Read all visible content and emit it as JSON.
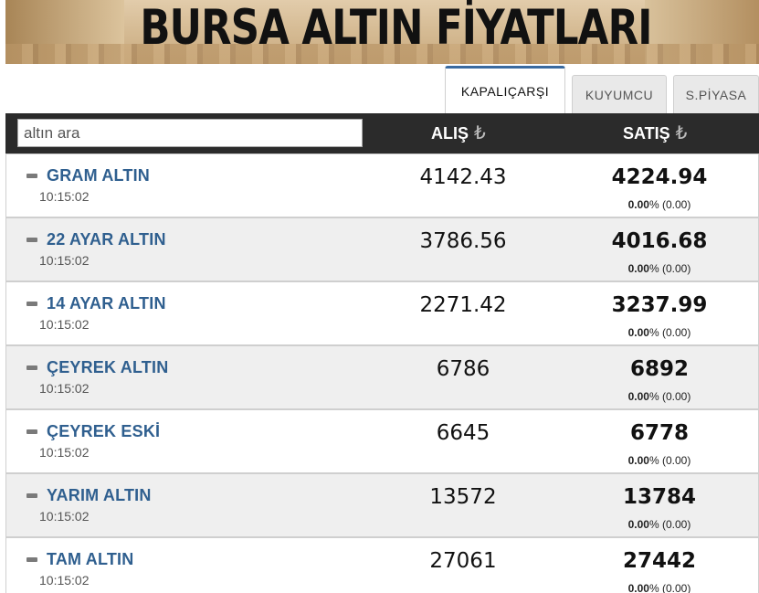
{
  "banner": {
    "title": "BURSA ALTIN FİYATLARI"
  },
  "tabs": [
    {
      "label": "KAPALIÇARŞI",
      "active": true
    },
    {
      "label": "KUYUMCU",
      "active": false
    },
    {
      "label": "S.PİYASA",
      "active": false
    }
  ],
  "search": {
    "placeholder": "altın ara",
    "value": ""
  },
  "columns": {
    "buy": "ALIŞ",
    "sell": "SATIŞ",
    "currency_icon": "₺"
  },
  "rows": [
    {
      "name": "GRAM ALTIN",
      "time": "10:15:02",
      "buy": "4142.43",
      "sell": "4224.94",
      "change_pct": "0.00",
      "pct_sign": "%",
      "change_abs": "(0.00)"
    },
    {
      "name": "22 AYAR ALTIN",
      "time": "10:15:02",
      "buy": "3786.56",
      "sell": "4016.68",
      "change_pct": "0.00",
      "pct_sign": "%",
      "change_abs": "(0.00)"
    },
    {
      "name": "14 AYAR ALTIN",
      "time": "10:15:02",
      "buy": "2271.42",
      "sell": "3237.99",
      "change_pct": "0.00",
      "pct_sign": "%",
      "change_abs": "(0.00)"
    },
    {
      "name": "ÇEYREK ALTIN",
      "time": "10:15:02",
      "buy": "6786",
      "sell": "6892",
      "change_pct": "0.00",
      "pct_sign": "%",
      "change_abs": "(0.00)"
    },
    {
      "name": "ÇEYREK ESKİ",
      "time": "10:15:02",
      "buy": "6645",
      "sell": "6778",
      "change_pct": "0.00",
      "pct_sign": "%",
      "change_abs": "(0.00)"
    },
    {
      "name": "YARIM ALTIN",
      "time": "10:15:02",
      "buy": "13572",
      "sell": "13784",
      "change_pct": "0.00",
      "pct_sign": "%",
      "change_abs": "(0.00)"
    },
    {
      "name": "TAM ALTIN",
      "time": "10:15:02",
      "buy": "27061",
      "sell": "27442",
      "change_pct": "0.00",
      "pct_sign": "%",
      "change_abs": "(0.00)"
    }
  ],
  "colors": {
    "accent": "#3a6aa0",
    "name_link": "#2f5f8f",
    "header_bg": "#2b2b2b"
  }
}
